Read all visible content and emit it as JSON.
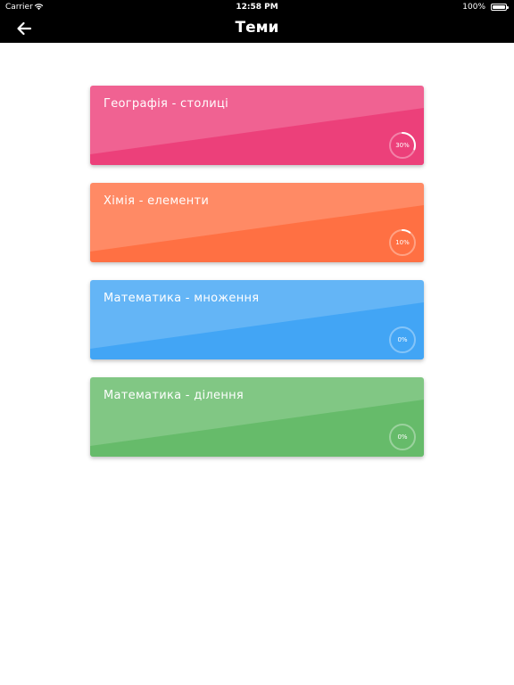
{
  "status_bar": {
    "carrier": "Carrier",
    "time": "12:58 PM",
    "battery": "100%",
    "wifi_icon": "wifi-icon",
    "battery_icon": "battery-icon"
  },
  "header": {
    "title": "Теми",
    "back_icon": "arrow-left-icon"
  },
  "topics": [
    {
      "title": "Географія - столиці",
      "progress_label": "30%",
      "progress": 0.3,
      "color_top": "#f06292",
      "color_bottom": "#ec407a"
    },
    {
      "title": "Хімія - елементи",
      "progress_label": "10%",
      "progress": 0.1,
      "color_top": "#ff8a65",
      "color_bottom": "#ff7043"
    },
    {
      "title": "Математика - множення",
      "progress_label": "0%",
      "progress": 0,
      "color_top": "#64b5f6",
      "color_bottom": "#42a5f5"
    },
    {
      "title": "Математика - ділення",
      "progress_label": "0%",
      "progress": 0,
      "color_top": "#81c784",
      "color_bottom": "#66bb6a"
    }
  ]
}
